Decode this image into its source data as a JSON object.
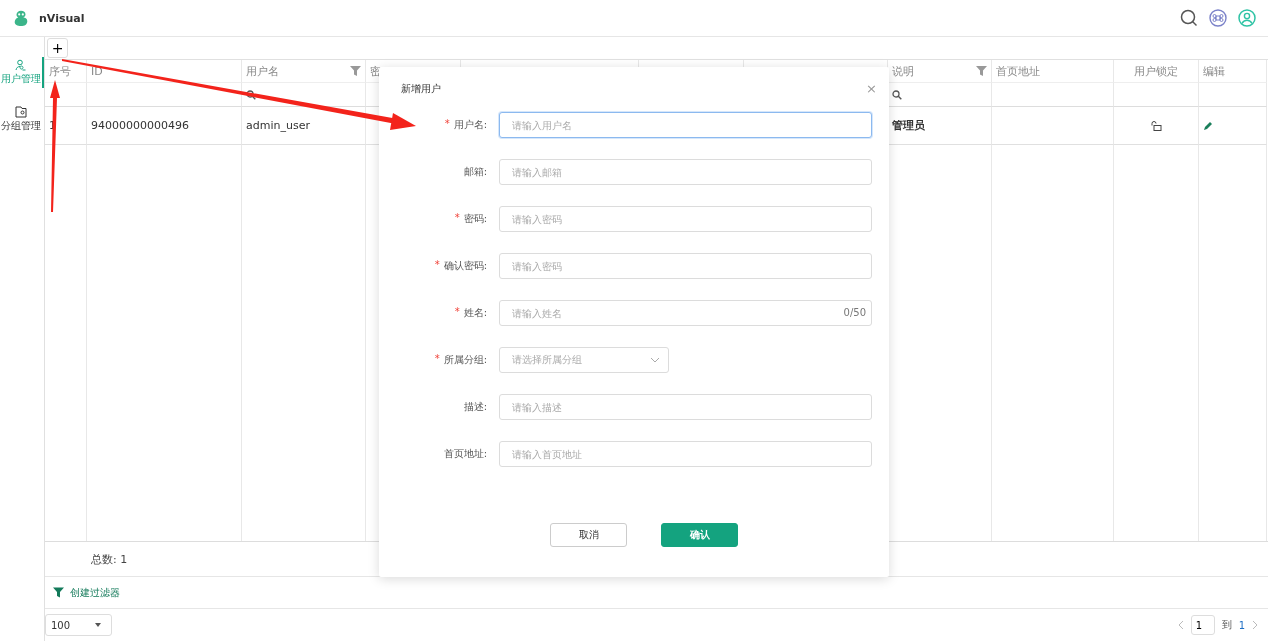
{
  "app": {
    "name": "nVisual"
  },
  "sidebar": {
    "items": [
      {
        "label": "用户管理",
        "selected": true
      },
      {
        "label": "分组管理",
        "selected": false
      }
    ]
  },
  "toolbar": {
    "add_button": "+"
  },
  "table": {
    "columns": [
      {
        "label": "序号",
        "filterable": false
      },
      {
        "label": "ID",
        "filterable": false
      },
      {
        "label": "用户名",
        "filterable": true
      },
      {
        "label": "密",
        "filterable": false
      },
      {},
      {},
      {},
      {
        "label": "说明",
        "filterable": true
      },
      {
        "label": "首页地址",
        "filterable": false
      },
      {
        "label": "用户锁定",
        "filterable": false
      },
      {
        "label": "编辑",
        "filterable": false
      }
    ],
    "rows": [
      {
        "cells": [
          "1",
          "94000000000496",
          "admin_user",
          "",
          "",
          "",
          "",
          "管理员",
          "",
          "",
          ""
        ],
        "locked": false
      }
    ],
    "total": "总数: 1"
  },
  "filter_link": "创建过滤器",
  "pagination": {
    "page_size": "100",
    "page": "1",
    "to_label": "到",
    "total_pages": "1"
  },
  "dialog": {
    "title": "新增用户",
    "close": "×",
    "fields": [
      {
        "kind": "text",
        "required_mark": "*",
        "label": "用户名:",
        "placeholder": "请输入用户名",
        "focused": true
      },
      {
        "kind": "text",
        "label": "邮箱:",
        "placeholder": "请输入邮箱",
        "focused": false
      },
      {
        "kind": "text",
        "required_mark": "*",
        "label": "密码:",
        "placeholder": "请输入密码",
        "focused": false
      },
      {
        "kind": "text",
        "required_mark": "*",
        "label": "确认密码:",
        "placeholder": "请输入密码",
        "focused": false
      },
      {
        "kind": "text",
        "required_mark": "*",
        "label": "姓名:",
        "placeholder": "请输入姓名",
        "focused": false,
        "counter": "0/50"
      },
      {
        "kind": "select",
        "required_mark": "*",
        "label": "所属分组:",
        "placeholder": "请选择所属分组"
      },
      {
        "kind": "text",
        "label": "描述:",
        "placeholder": "请输入描述",
        "focused": false
      },
      {
        "kind": "text",
        "label": "首页地址:",
        "placeholder": "请输入首页地址",
        "focused": false
      }
    ],
    "buttons": [
      {
        "label": "取消",
        "kind": "secondary"
      },
      {
        "label": "确认",
        "kind": "primary"
      }
    ]
  }
}
